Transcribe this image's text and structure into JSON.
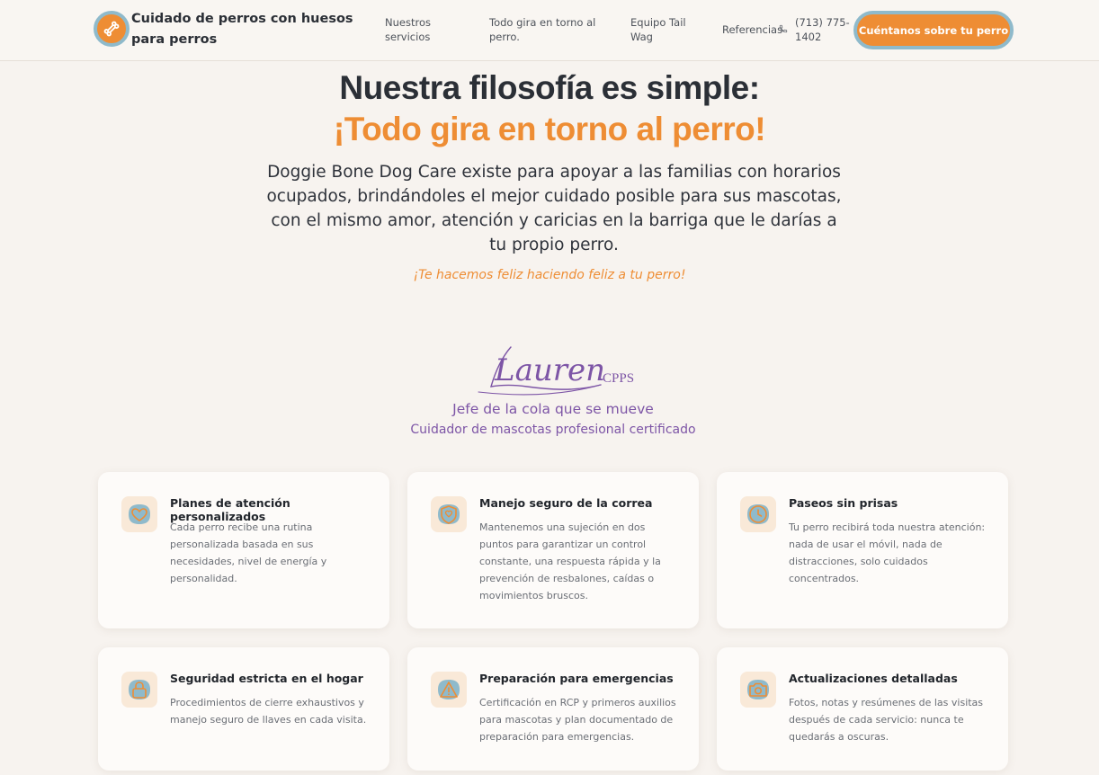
{
  "header": {
    "brand": "Cuidado de perros con huesos para perros",
    "nav": [
      "Nuestros servicios",
      "Todo gira en torno al perro.",
      "Equipo Tail Wag",
      "Referencias"
    ],
    "phone": "(713) 775-1402",
    "cta": "Cuéntanos sobre tu perro"
  },
  "hero": {
    "title_line1": "Nuestra filosofía es simple:",
    "title_line2": "¡Todo gira en torno al perro!",
    "body": "Doggie Bone Dog Care existe para apoyar a las familias con horarios ocupados, brindándoles el mejor cuidado posible para sus mascotas, con el mismo amor, atención y caricias en la barriga que le darías a tu propio perro.",
    "tagline": "¡Te hacemos feliz haciendo feliz a tu perro!"
  },
  "signature": {
    "name": "Lauren",
    "credential": "CPPS",
    "role": "Jefe de la cola que se mueve",
    "certification": "Cuidador de mascotas profesional certificado"
  },
  "cards": [
    {
      "icon": "heart-icon",
      "title": "Planes de atención personalizados",
      "desc": "Cada perro recibe una rutina personalizada basada en sus necesidades, nivel de energía y personalidad."
    },
    {
      "icon": "shield-icon",
      "title": "Manejo seguro de la correa",
      "desc": "Mantenemos una sujeción en dos puntos para garantizar un control constante, una respuesta rápida y la prevención de resbalones, caídas o movimientos bruscos."
    },
    {
      "icon": "clock-icon",
      "title": "Paseos sin prisas",
      "desc": "Tu perro recibirá toda nuestra atención: nada de usar el móvil, nada de distracciones, solo cuidados concentrados."
    },
    {
      "icon": "lock-icon",
      "title": "Seguridad estricta en el hogar",
      "desc": "Procedimientos de cierre exhaustivos y manejo seguro de llaves en cada visita."
    },
    {
      "icon": "warning-icon",
      "title": "Preparación para emergencias",
      "desc": "Certificación en RCP y primeros auxilios para mascotas y plan documentado de preparación para emergencias."
    },
    {
      "icon": "camera-icon",
      "title": "Actualizaciones detalladas",
      "desc": "Fotos, notas y resúmenes de las visitas después de cada servicio: nunca te quedarás a oscuras."
    }
  ],
  "colors": {
    "accent": "#ee8d34",
    "ring": "#8fbacb",
    "purple": "#7d55a6",
    "background": "#f7f3ef"
  }
}
